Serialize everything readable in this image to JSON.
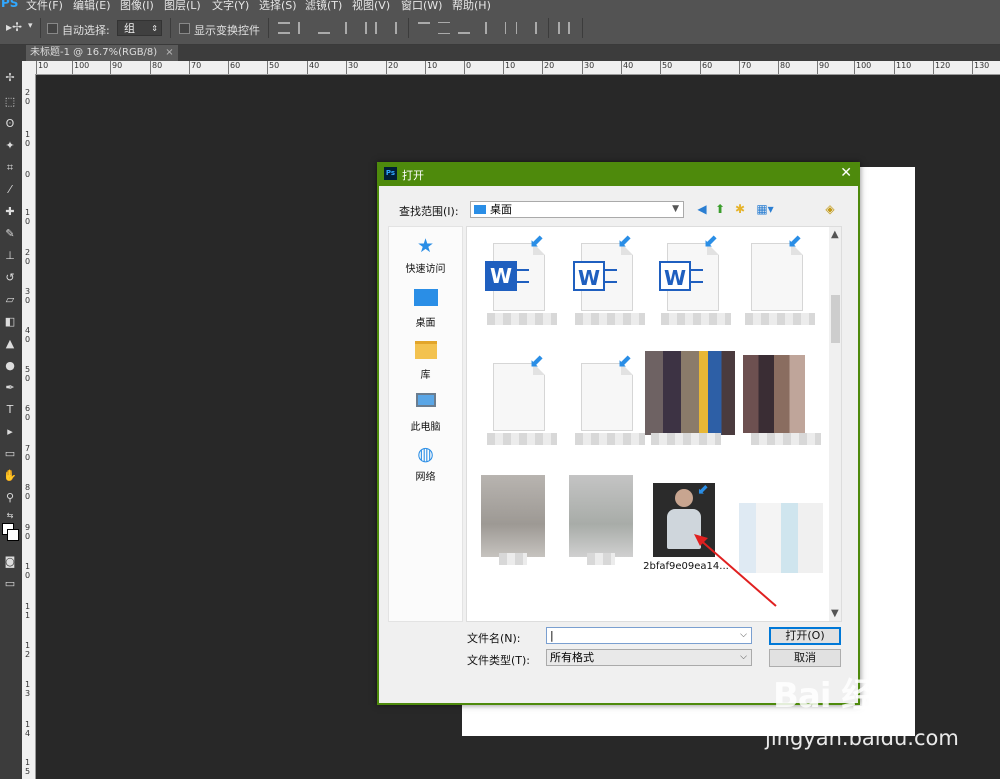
{
  "menubar": {
    "logo": "PS",
    "items": [
      "文件(F)",
      "编辑(E)",
      "图像(I)",
      "图层(L)",
      "文字(Y)",
      "选择(S)",
      "滤镜(T)",
      "视图(V)",
      "窗口(W)",
      "帮助(H)"
    ]
  },
  "options": {
    "auto_select_label": "自动选择:",
    "group_value": "组",
    "show_transform_label": "显示变换控件"
  },
  "document_tab": {
    "label": "未标题-1 @ 16.7%(RGB/8)",
    "close": "×"
  },
  "rulers": {
    "h_ticks": [
      "10",
      "100",
      "90",
      "80",
      "70",
      "60",
      "50",
      "40",
      "30",
      "20",
      "10",
      "0",
      "10",
      "20",
      "30",
      "40",
      "50",
      "60",
      "70",
      "80",
      "90",
      "100",
      "110",
      "120",
      "130"
    ],
    "v_ticks": [
      "2 0",
      "1 0",
      "0",
      "1 0",
      "2 0",
      "3 0",
      "4 0",
      "5 0",
      "6 0",
      "7 0",
      "8 0",
      "9 0",
      "1 0",
      "1 1",
      "1 2",
      "1 3",
      "1 4",
      "1 5"
    ]
  },
  "dialog": {
    "title": "打开",
    "ps_badge": "Ps",
    "close": "✕",
    "look_in_label": "查找范围(I):",
    "look_in_value": "桌面",
    "places": [
      {
        "label": "快速访问",
        "icon": "star-icon"
      },
      {
        "label": "桌面",
        "icon": "desktop-icon"
      },
      {
        "label": "库",
        "icon": "library-folder-icon"
      },
      {
        "label": "此电脑",
        "icon": "computer-icon"
      },
      {
        "label": "网络",
        "icon": "network-icon"
      }
    ],
    "files": {
      "selected_name": "2bfaf9e09ea14..."
    },
    "filename_label": "文件名(N):",
    "filename_value": "",
    "filetype_label": "文件类型(T):",
    "filetype_value": "所有格式",
    "open_button": "打开(O)",
    "cancel_button": "取消"
  },
  "watermark": {
    "logo": "Bai  经验",
    "url": "jingyan.baidu.com"
  }
}
